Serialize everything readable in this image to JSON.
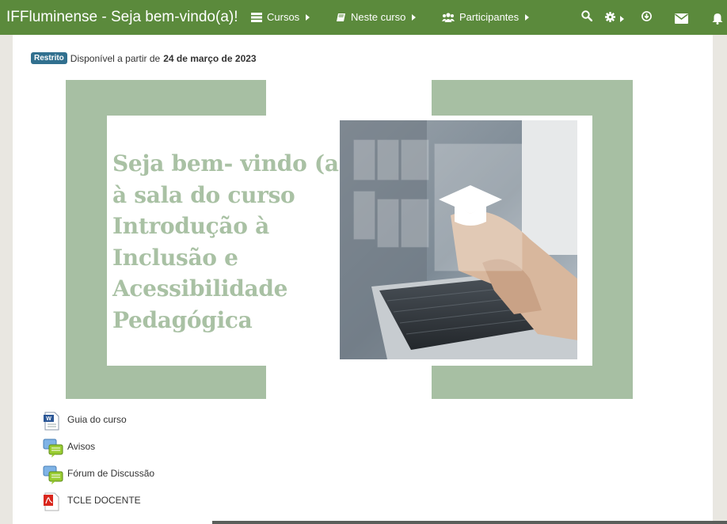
{
  "navbar": {
    "brand": "IFFluminense - Seja bem-vindo(a)!",
    "items": [
      {
        "label": "Cursos",
        "icon": "courses-icon"
      },
      {
        "label": "Neste curso",
        "icon": "book-icon"
      },
      {
        "label": "Participantes",
        "icon": "users-icon"
      }
    ],
    "right_icons": [
      "search-icon",
      "gear-icon",
      "download-icon",
      "mail-icon",
      "bell-icon"
    ],
    "color": "#5b8a3c"
  },
  "restriction": {
    "badge": "Restrito",
    "text_prefix": "Disponível a partir de",
    "date": "24 de março de 2023"
  },
  "banner": {
    "lines": [
      "Seja bem- vindo (a)",
      "à sala do curso",
      "Introdução à",
      "Inclusão e",
      "Acessibilidade",
      "Pedagógica"
    ],
    "green": "#a7bfa3",
    "text_color": "#a9c1a4"
  },
  "activities": [
    {
      "label": "Guia do curso",
      "icon": "word-doc-icon"
    },
    {
      "label": "Avisos",
      "icon": "forum-icon"
    },
    {
      "label": "Fórum de Discussão",
      "icon": "forum-icon"
    },
    {
      "label": "TCLE DOCENTE",
      "icon": "pdf-icon"
    }
  ]
}
